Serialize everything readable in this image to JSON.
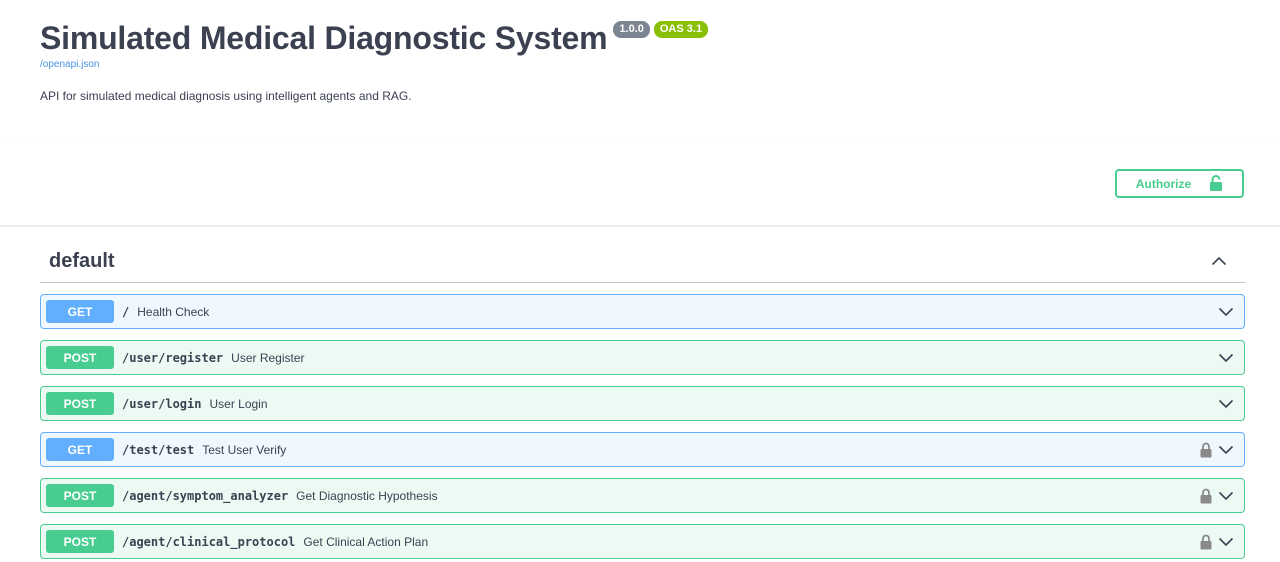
{
  "info": {
    "title": "Simulated Medical Diagnostic System",
    "version": "1.0.0",
    "oas": "OAS 3.1",
    "spec_link": "/openapi.json",
    "description": "API for simulated medical diagnosis using intelligent agents and RAG."
  },
  "auth": {
    "authorize_label": "Authorize",
    "icon": "unlocked-padlock-icon"
  },
  "tag": {
    "name": "default",
    "icon": "chevron-up-icon"
  },
  "operations": [
    {
      "method": "GET",
      "path": "/",
      "summary": "Health Check",
      "locked": false
    },
    {
      "method": "POST",
      "path": "/user/register",
      "summary": "User Register",
      "locked": false
    },
    {
      "method": "POST",
      "path": "/user/login",
      "summary": "User Login",
      "locked": false
    },
    {
      "method": "GET",
      "path": "/test/test",
      "summary": "Test User Verify",
      "locked": true
    },
    {
      "method": "POST",
      "path": "/agent/symptom_analyzer",
      "summary": "Get Diagnostic Hypothesis",
      "locked": true
    },
    {
      "method": "POST",
      "path": "/agent/clinical_protocol",
      "summary": "Get Clinical Action Plan",
      "locked": true
    }
  ],
  "colors": {
    "get": "#61affe",
    "post": "#49cc90",
    "text": "#3b4151",
    "link": "#4990e2",
    "version_badge": "#7d8492",
    "oas_badge": "#89bf04"
  }
}
